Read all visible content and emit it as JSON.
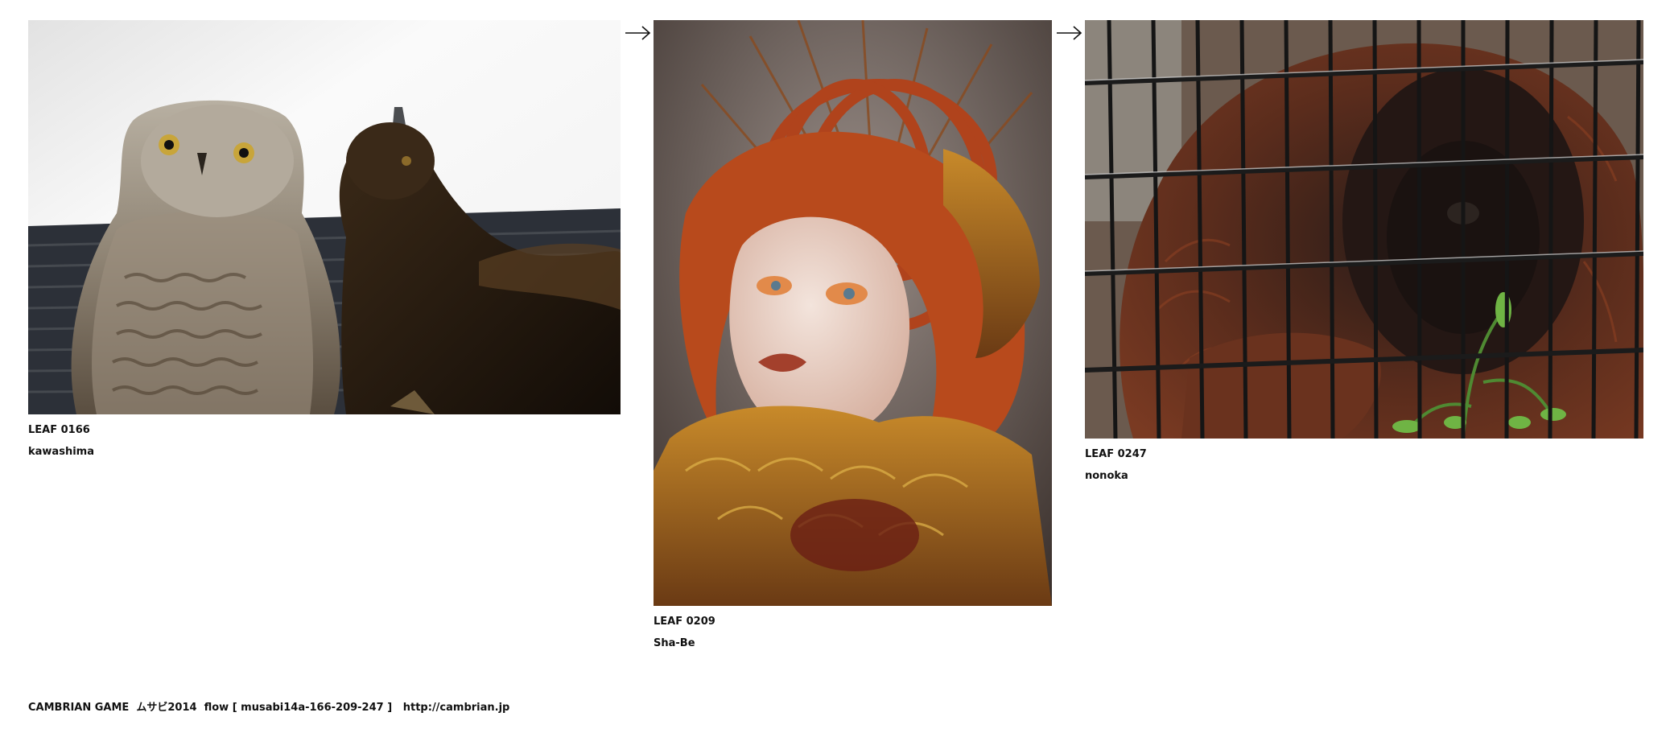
{
  "leaves": [
    {
      "id": "LEAF 0166",
      "author": "kawashima",
      "image": "photo of two birds of prey, a snowy owl and an eagle"
    },
    {
      "id": "LEAF 0209",
      "author": "Sha-Be",
      "image": "portrait of a woman with red braided hair and a feather headdress"
    },
    {
      "id": "LEAF 0247",
      "author": "nonoka",
      "image": "orangutan behind a black wire cage"
    }
  ],
  "arrows": [
    "arrow-right-icon",
    "arrow-right-icon"
  ],
  "footer": {
    "title": "CAMBRIAN GAME  ムサビ2014  flow [ musabi14a-166-209-247 ]",
    "link": "http://cambrian.jp"
  }
}
